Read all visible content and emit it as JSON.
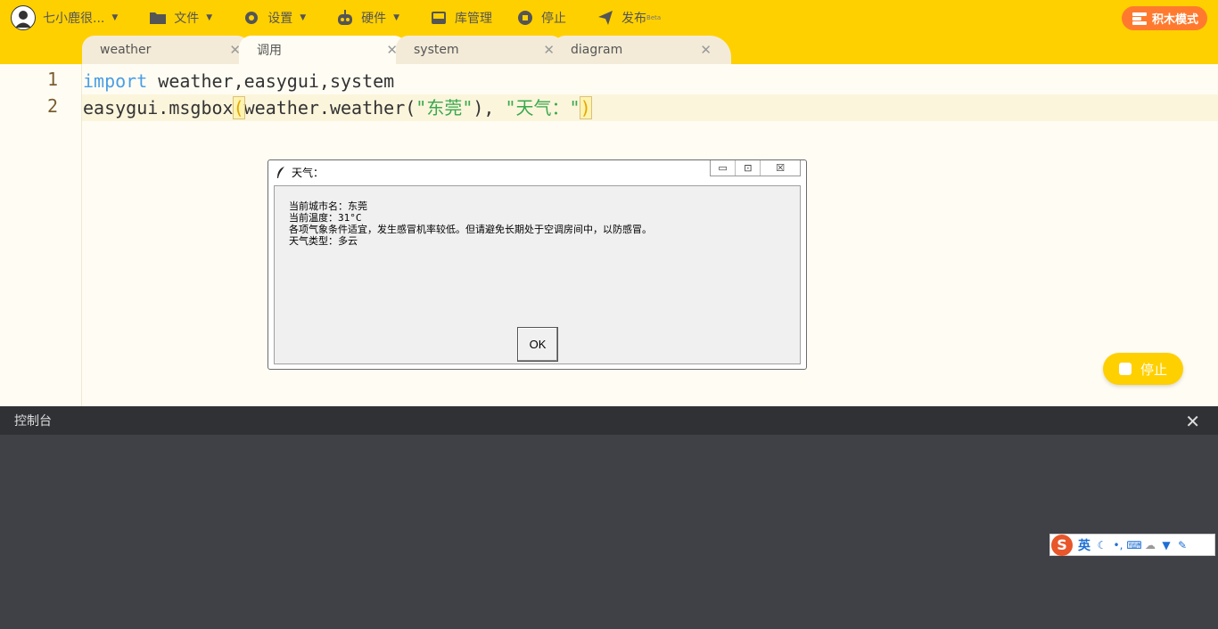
{
  "toolbar": {
    "username": "七小鹿很...",
    "file": "文件",
    "settings": "设置",
    "hardware": "硬件",
    "library": "库管理",
    "stop": "停止",
    "publish": "发布",
    "publish_badge": "Beta",
    "block_mode": "积木模式"
  },
  "tabs": [
    {
      "label": "weather",
      "active": false
    },
    {
      "label": "调用",
      "active": true
    },
    {
      "label": "system",
      "active": false
    },
    {
      "label": "diagram",
      "active": false
    }
  ],
  "editor": {
    "line_numbers": [
      "1",
      "2"
    ],
    "line1": {
      "keyword": "import",
      "rest": " weather,easygui,system"
    },
    "line2": {
      "prefix": "easygui.msgbox",
      "open_paren": "(",
      "call": "weather.weather(",
      "arg1": "\"东莞\"",
      "mid": "), ",
      "arg2": "\"天气：\"",
      "close_paren": ")"
    }
  },
  "dialog": {
    "title": "天气：",
    "lines": [
      "当前城市名：东莞",
      "当前温度：31°C",
      "各项气象条件适宜，发生感冒机率较低。但请避免长期处于空调房间中，以防感冒。",
      "天气类型：多云"
    ],
    "ok_label": "OK"
  },
  "stop_button": "停止",
  "console": {
    "title": "控制台"
  },
  "ime": {
    "lang": "英"
  },
  "colors": {
    "brand_yellow": "#ffd000",
    "accent_orange": "#ff7a2e",
    "keyword_blue": "#4a9ee6",
    "string_green": "#3aa84d",
    "console_bg": "#3f4146"
  }
}
